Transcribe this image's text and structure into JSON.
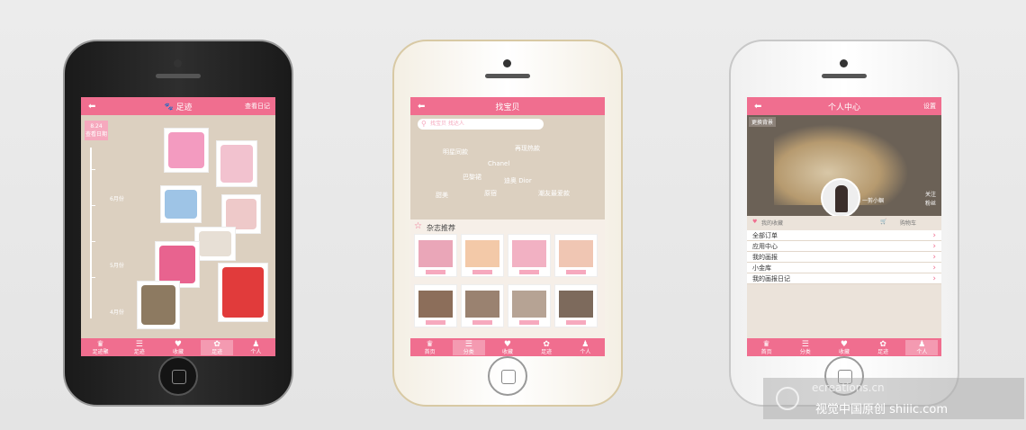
{
  "colors": {
    "accent": "#f06e8f",
    "accent_light": "#f6a9be",
    "bg": "#dcd0c0"
  },
  "phone1": {
    "title": "足迹",
    "right_action": "查看日记",
    "date_badge": "8.24",
    "date_badge_sub": "查看日期",
    "months": [
      "6月份",
      "5月份",
      "4月份"
    ],
    "tabs": [
      "足迹聚",
      "足迹",
      "收藏",
      "足迹",
      "个人"
    ]
  },
  "phone2": {
    "title": "找宝贝",
    "search_placeholder": "找宝贝 找达人",
    "keywords": [
      "明星同款",
      "再现热款",
      "Chanel",
      "巴黎裙",
      "迪奥 Dior",
      "甜美",
      "原宿",
      "潮友最爱款"
    ],
    "section_title": "杂志推荐",
    "tabs": [
      "首页",
      "分类",
      "收藏",
      "足迹",
      "个人"
    ]
  },
  "phone3": {
    "title": "个人中心",
    "right_action": "设置",
    "edit_label": "更换背景",
    "name": "一剪小蝈",
    "follow": "关注",
    "fans": "粉丝",
    "fav_label": "我的收藏",
    "cart_label": "购物车",
    "menu": [
      "全部订单",
      "应用中心",
      "我的画报",
      "小金库",
      "我的画报日记"
    ],
    "tabs": [
      "首页",
      "分类",
      "收藏",
      "足迹",
      "个人"
    ]
  },
  "watermark": {
    "top": "ecreations.cn",
    "bottom": "视觉中国原创 shiiic.com"
  }
}
